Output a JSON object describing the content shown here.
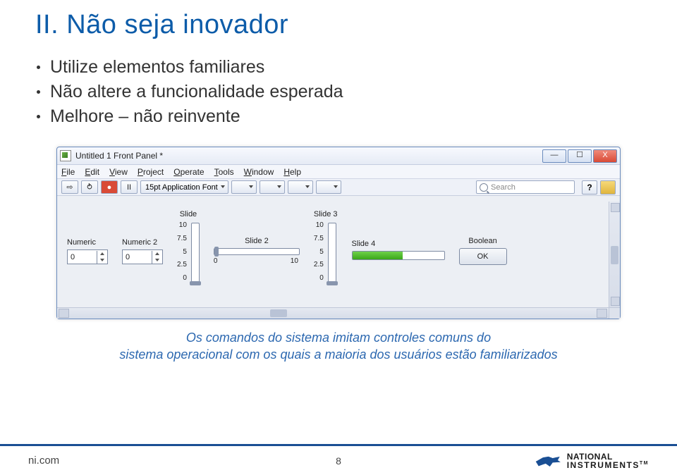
{
  "title": "II. Não seja inovador",
  "bullets": [
    "Utilize elementos familiares",
    "Não altere a funcionalidade esperada",
    "Melhore – não reinvente"
  ],
  "window": {
    "title": "Untitled 1 Front Panel *",
    "min_glyph": "—",
    "max_glyph": "☐",
    "close_glyph": "X",
    "menu": {
      "file": "File",
      "edit": "Edit",
      "view": "View",
      "project": "Project",
      "operate": "Operate",
      "tools": "Tools",
      "window": "Window",
      "help": "Help"
    },
    "toolbar": {
      "run": "⇨",
      "run_cont": "⥁",
      "abort": "●",
      "pause": "II",
      "font": "15pt Application Font",
      "search_placeholder": "Search",
      "help": "?"
    },
    "controls": {
      "numeric1": {
        "label": "Numeric",
        "value": "0"
      },
      "numeric2": {
        "label": "Numeric 2",
        "value": "0"
      },
      "slide": {
        "label": "Slide",
        "ticks": [
          "10",
          "7.5",
          "5",
          "2.5",
          "0"
        ]
      },
      "slide2": {
        "label": "Slide 2",
        "ticks": [
          "0",
          "10"
        ]
      },
      "slide3": {
        "label": "Slide 3",
        "ticks": [
          "10",
          "7.5",
          "5",
          "2.5",
          "0"
        ]
      },
      "slide4": {
        "label": "Slide 4"
      },
      "boolean": {
        "label": "Boolean",
        "ok": "OK"
      }
    }
  },
  "caption_line1": "Os comandos do sistema imitam controles comuns do",
  "caption_line2": "sistema operacional com os quais a maioria dos usuários estão familiarizados",
  "footer": {
    "nicom": "ni.com",
    "page": "8",
    "logo_top": "NATIONAL",
    "logo_bot": "INSTRUMENTS",
    "tm": "TM"
  }
}
